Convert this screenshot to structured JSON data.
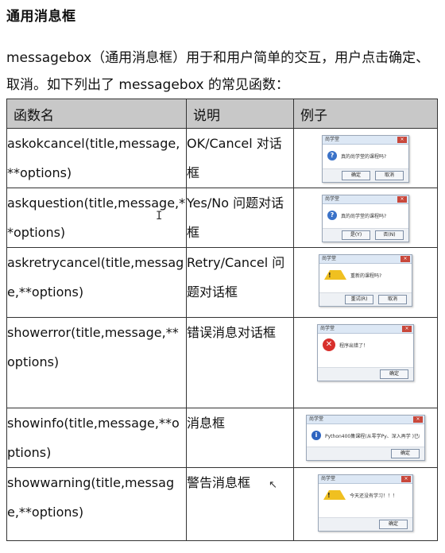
{
  "title": "通用消息框",
  "intro": "messagebox（通用消息框）用于和用户简单的交互，用户点击确定、取消。如下列出了 messagebox 的常见函数：",
  "table": {
    "headers": [
      "函数名",
      "说明",
      "例子"
    ],
    "rows": [
      {
        "func": "askokcancel(title,message,**options)",
        "desc": "OK/Cancel 对话框",
        "dialog": {
          "title": "尚学堂",
          "icon": "question-icon",
          "message": "真的尚学堂的课程吗?",
          "buttons": [
            "确定",
            "取消"
          ]
        }
      },
      {
        "func": "askquestion(title,message,**options)",
        "desc": "Yes/No 问题对话框",
        "dialog": {
          "title": "尚学堂",
          "icon": "question-icon",
          "message": "真的尚学堂的课程吗?",
          "buttons": [
            "是(Y)",
            "否(N)"
          ]
        }
      },
      {
        "func": "askretrycancel(title,message,**options)",
        "desc": "Retry/Cancel 问题对话框",
        "dialog": {
          "title": "尚学堂",
          "icon": "warning-icon",
          "message": "重新的课程吗?",
          "buttons": [
            "重试(R)",
            "取消"
          ]
        }
      },
      {
        "func": "showerror(title,message,**options)",
        "desc": "错误消息对话框",
        "dialog": {
          "title": "尚学堂",
          "icon": "error-icon",
          "message": "程序出错了！",
          "buttons": [
            "确定"
          ]
        }
      },
      {
        "func": "showinfo(title,message,**options)",
        "desc": "消息框",
        "dialog": {
          "title": "尚学堂",
          "icon": "info-icon",
          "message": "Python400集课程(从零学Py、深入再学 )已经免费",
          "buttons": [
            "确定"
          ]
        }
      },
      {
        "func": "showwarning(title,message,**options)",
        "desc": "警告消息框",
        "dialog": {
          "title": "尚学堂",
          "icon": "warning-icon",
          "message": "今天还没有学习！！！",
          "buttons": [
            "确定"
          ]
        }
      }
    ]
  }
}
